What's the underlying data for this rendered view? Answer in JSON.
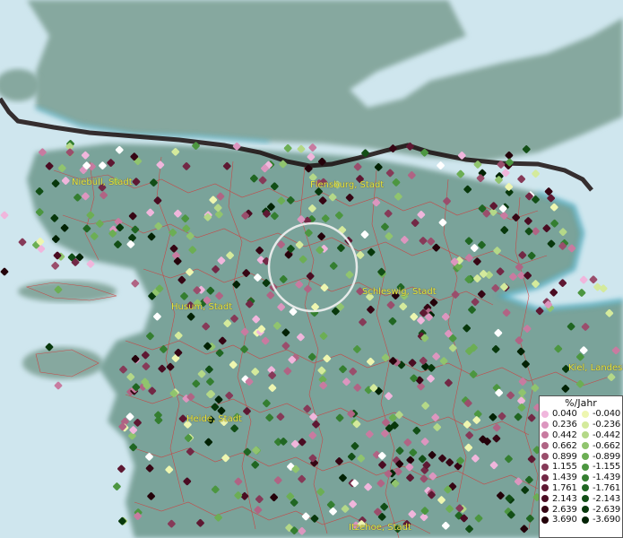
{
  "map": {
    "cities": [
      {
        "name": "Niebüll, Stadt"
      },
      {
        "name": "Flensburg, Stadt"
      },
      {
        "name": "Schleswig, Stadt"
      },
      {
        "name": "Husum, Stadt"
      },
      {
        "name": "Heide, Stadt"
      },
      {
        "name": "Kiel, Landeshauptstadt"
      },
      {
        "name": "Itzehoe, Stadt"
      }
    ],
    "colors": {
      "sea": "#cfe6ee",
      "land": "#7aa39a",
      "land_north": "#86a89f",
      "border": "#1a0d0d",
      "admin_lines": "#d23a3a",
      "coast_shadow": "#2aa6c8"
    }
  },
  "legend": {
    "title": "%/Jahr",
    "positive": [
      {
        "label": "0.040",
        "color": "#f0b6dc"
      },
      {
        "label": "0.236",
        "color": "#dc96bf"
      },
      {
        "label": "0.442",
        "color": "#c87ba0"
      },
      {
        "label": "0.662",
        "color": "#b06484"
      },
      {
        "label": "0.899",
        "color": "#9a4e6c"
      },
      {
        "label": "1.155",
        "color": "#863a58"
      },
      {
        "label": "1.439",
        "color": "#722845"
      },
      {
        "label": "1.761",
        "color": "#5e1832"
      },
      {
        "label": "2.143",
        "color": "#4a0c22"
      },
      {
        "label": "2.639",
        "color": "#360614"
      },
      {
        "label": "3.690",
        "color": "#24020a"
      }
    ],
    "negative": [
      {
        "label": "-0.040",
        "color": "#eef6b0"
      },
      {
        "label": "-0.236",
        "color": "#d4ea9c"
      },
      {
        "label": "-0.442",
        "color": "#b4d888"
      },
      {
        "label": "-0.662",
        "color": "#90c46e"
      },
      {
        "label": "-0.899",
        "color": "#6cae54"
      },
      {
        "label": "-1.155",
        "color": "#4c9640"
      },
      {
        "label": "-1.439",
        "color": "#347e30"
      },
      {
        "label": "-1.761",
        "color": "#206622"
      },
      {
        "label": "-2.143",
        "color": "#124e16"
      },
      {
        "label": "-2.639",
        "color": "#08380c"
      },
      {
        "label": "-3.690",
        "color": "#022204"
      }
    ]
  }
}
